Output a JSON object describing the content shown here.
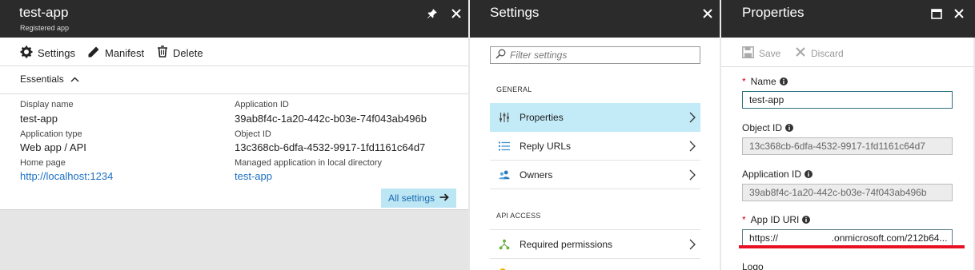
{
  "app_blade": {
    "title": "test-app",
    "subtitle": "Registered app",
    "commands": {
      "settings": "Settings",
      "manifest": "Manifest",
      "delete": "Delete"
    },
    "essentials_label": "Essentials",
    "fields": {
      "display_name_label": "Display name",
      "display_name": "test-app",
      "app_type_label": "Application type",
      "app_type": "Web app / API",
      "home_page_label": "Home page",
      "home_page": "http://localhost:1234",
      "app_id_label": "Application ID",
      "app_id": "39ab8f4c-1a20-442c-b03e-74f043ab496b",
      "object_id_label": "Object ID",
      "object_id": "13c368cb-6dfa-4532-9917-1fd1161c64d7",
      "managed_app_label": "Managed application in local directory",
      "managed_app": "test-app"
    },
    "all_settings": "All settings"
  },
  "settings_blade": {
    "title": "Settings",
    "filter_placeholder": "Filter settings",
    "general_header": "GENERAL",
    "general_items": [
      {
        "label": "Properties",
        "icon": "sliders-icon"
      },
      {
        "label": "Reply URLs",
        "icon": "list-icon"
      },
      {
        "label": "Owners",
        "icon": "people-icon"
      }
    ],
    "api_header": "API ACCESS",
    "api_items": [
      {
        "label": "Required permissions",
        "icon": "network-icon"
      }
    ]
  },
  "properties_blade": {
    "title": "Properties",
    "save_label": "Save",
    "discard_label": "Discard",
    "name_label": "Name",
    "name_value": "test-app",
    "object_id_label": "Object ID",
    "object_id_value": "13c368cb-6dfa-4532-9917-1fd1161c64d7",
    "app_id_label": "Application ID",
    "app_id_value": "39ab8f4c-1a20-442c-b03e-74f043ab496b",
    "app_id_uri_label": "App ID URI",
    "app_id_uri_value": "https://                    .onmicrosoft.com/212b64...",
    "logo_label": "Logo"
  },
  "colors": {
    "header_bg": "#2b2b2b",
    "accent_link": "#1a70c4",
    "active_item": "#c2eaf7",
    "required": "#d0021b",
    "annotation_red": "#e81123"
  }
}
